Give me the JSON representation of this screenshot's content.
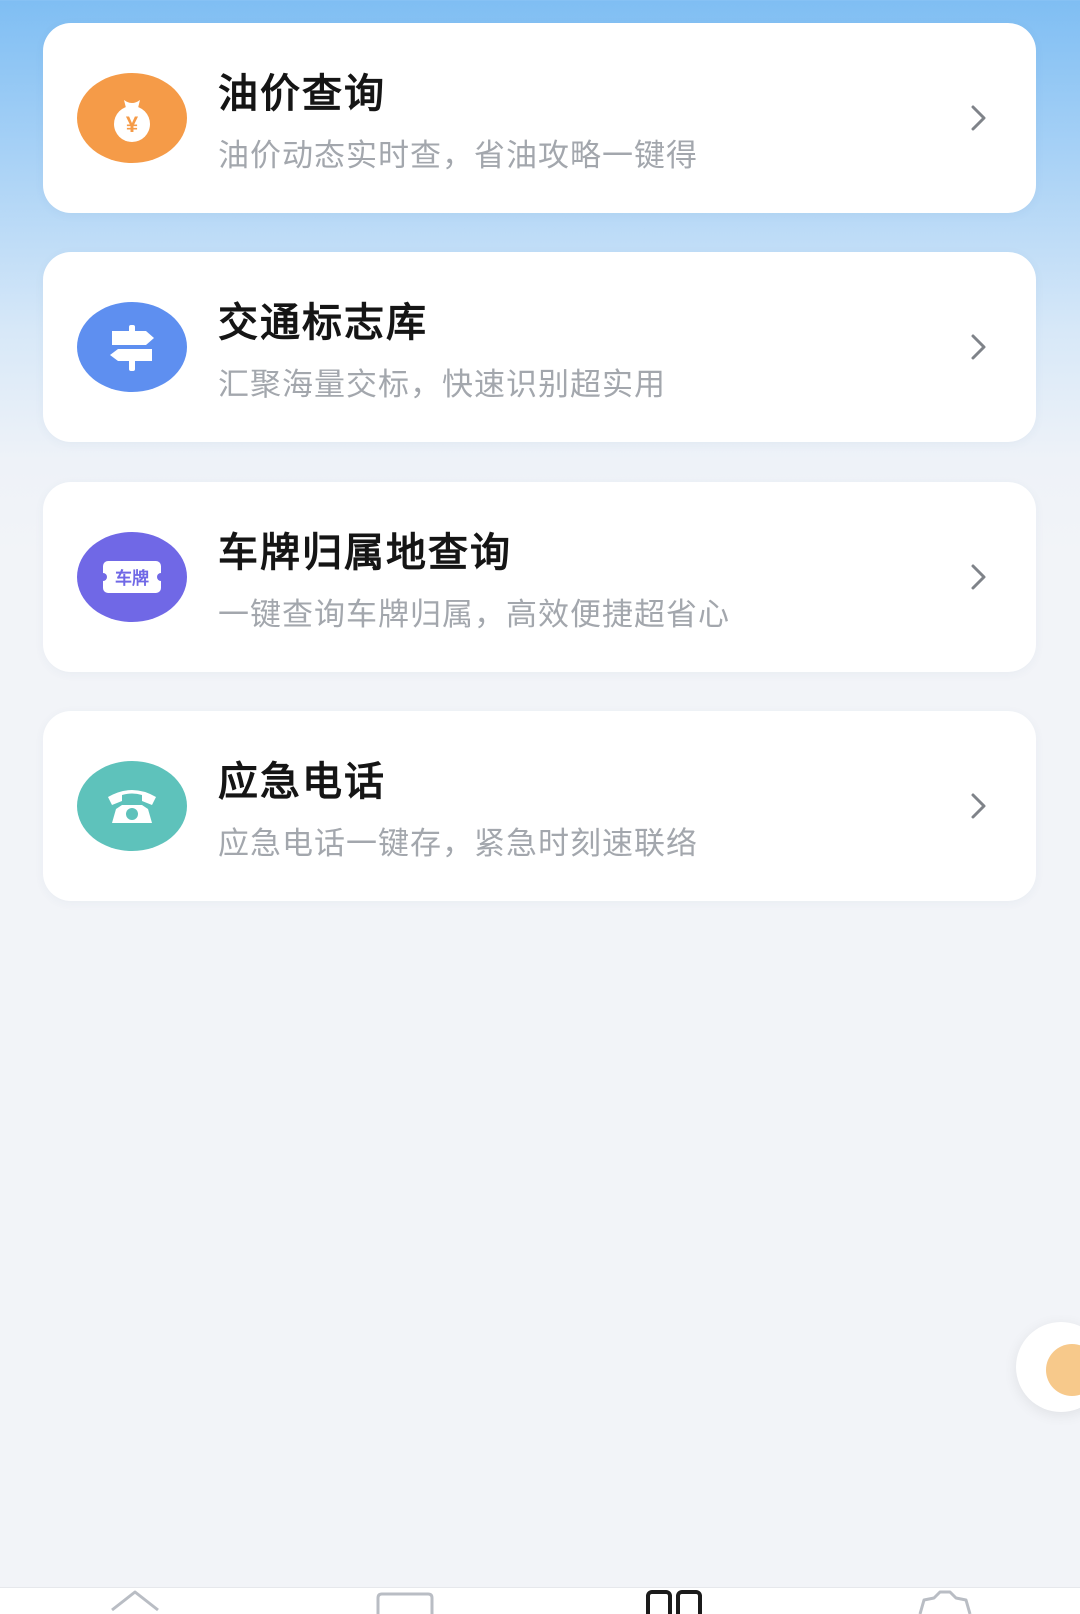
{
  "cards": [
    {
      "title": "油价查询",
      "subtitle": "油价动态实时查，省油攻略一键得",
      "icon": "oil-money-icon",
      "icon_glyph": "¥",
      "color": "#f59b48"
    },
    {
      "title": "交通标志库",
      "subtitle": "汇聚海量交标，快速识别超实用",
      "icon": "signpost-icon",
      "color": "#5e8ff0"
    },
    {
      "title": "车牌归属地查询",
      "subtitle": "一键查询车牌归属，高效便捷超省心",
      "icon": "license-plate-icon",
      "icon_glyph": "车牌",
      "color": "#7068e6"
    },
    {
      "title": "应急电话",
      "subtitle": "应急电话一键存，紧急时刻速联络",
      "icon": "telephone-icon",
      "color": "#5ec2bb"
    }
  ],
  "tabbar": {
    "items": [
      "home-icon",
      "message-icon",
      "grid-icon",
      "gear-icon"
    ],
    "active_index": 2
  },
  "colors": {
    "title": "#151515",
    "subtitle": "#a3a7ad",
    "float_button": "#f7c98b"
  }
}
